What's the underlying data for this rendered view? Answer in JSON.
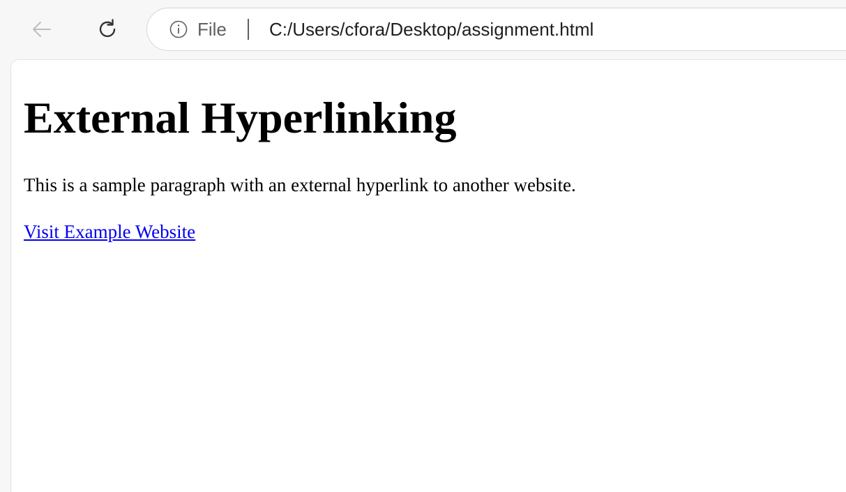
{
  "browser": {
    "back_icon": "arrow-left-icon",
    "reload_icon": "reload-icon",
    "info_icon": "info-icon",
    "scheme_label": "File",
    "url": "C:/Users/cfora/Desktop/assignment.html"
  },
  "page": {
    "title": "External Hyperlinking",
    "paragraph": "This is a sample paragraph with an external hyperlink to another website.",
    "link_text": "Visit Example Website"
  },
  "colors": {
    "link": "#0000ee",
    "toolbar_bg": "#f7f7f7",
    "content_bg": "#ffffff"
  }
}
